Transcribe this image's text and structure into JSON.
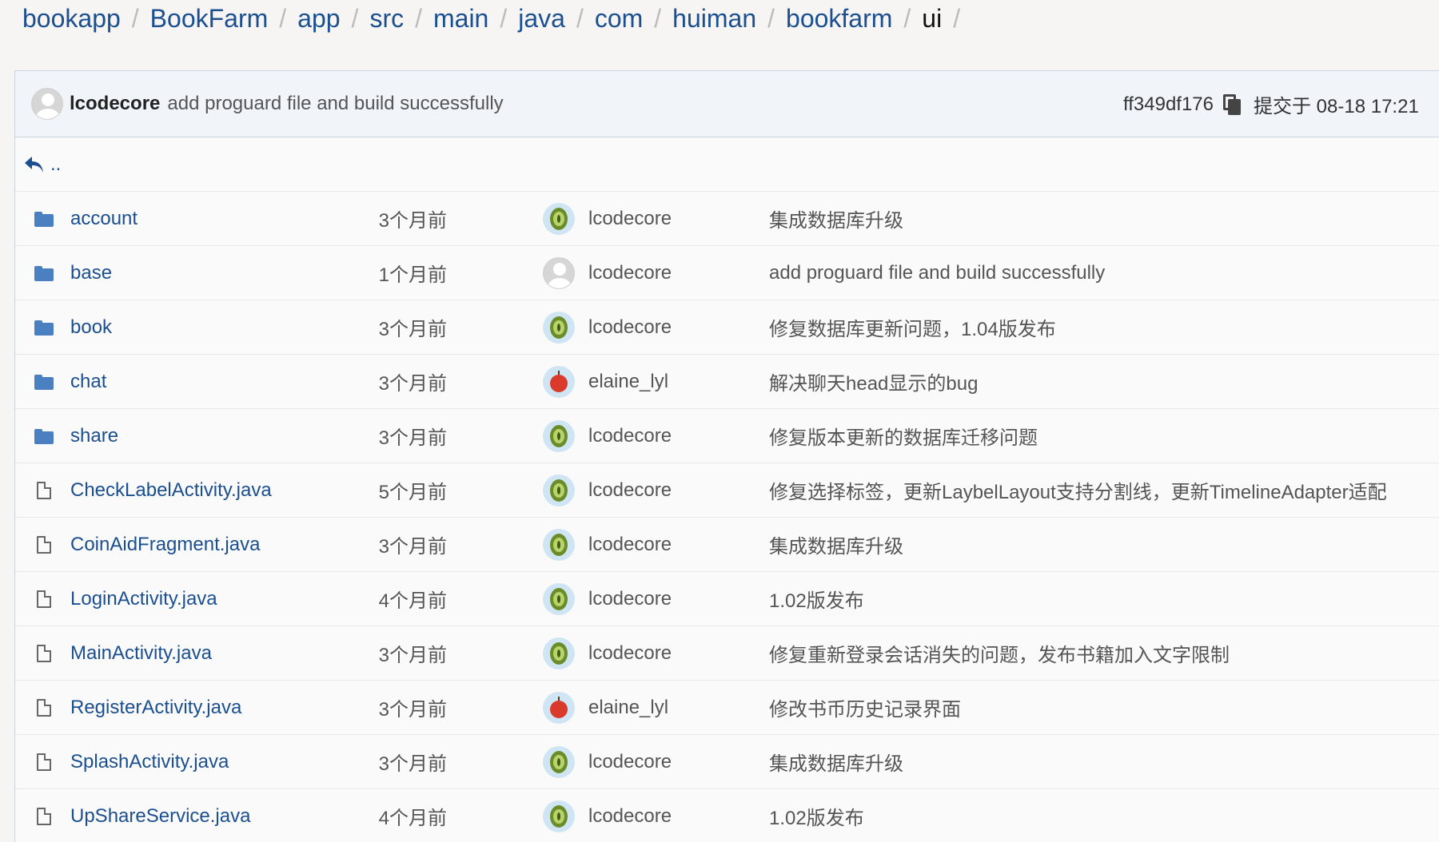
{
  "breadcrumb": [
    {
      "label": "bookapp"
    },
    {
      "label": "BookFarm"
    },
    {
      "label": "app"
    },
    {
      "label": "src"
    },
    {
      "label": "main"
    },
    {
      "label": "java"
    },
    {
      "label": "com"
    },
    {
      "label": "huiman"
    },
    {
      "label": "bookfarm"
    },
    {
      "label": "ui"
    }
  ],
  "breadcrumb_separator": "/",
  "latest_commit": {
    "author": "lcodecore",
    "message": "add proguard file and build successfully",
    "hash": "ff349df176",
    "copy_icon": "clipboard-icon",
    "date": "提交于 08-18 17:21"
  },
  "parent_link": {
    "label": "..",
    "icon": "reply-arrow-icon"
  },
  "rows": [
    {
      "type": "folder",
      "name": "account",
      "time": "3个月前",
      "avatar": "kiwi",
      "author": "lcodecore",
      "message": "集成数据库升级"
    },
    {
      "type": "folder",
      "name": "base",
      "time": "1个月前",
      "avatar": "default",
      "author": "lcodecore",
      "message": "add proguard file and build successfully"
    },
    {
      "type": "folder",
      "name": "book",
      "time": "3个月前",
      "avatar": "kiwi",
      "author": "lcodecore",
      "message": "修复数据库更新问题，1.04版发布"
    },
    {
      "type": "folder",
      "name": "chat",
      "time": "3个月前",
      "avatar": "apple",
      "author": "elaine_lyl",
      "message": "解决聊天head显示的bug"
    },
    {
      "type": "folder",
      "name": "share",
      "time": "3个月前",
      "avatar": "kiwi",
      "author": "lcodecore",
      "message": "修复版本更新的数据库迁移问题"
    },
    {
      "type": "file",
      "name": "CheckLabelActivity.java",
      "time": "5个月前",
      "avatar": "kiwi",
      "author": "lcodecore",
      "message": "修复选择标签，更新LaybelLayout支持分割线，更新TimelineAdapter适配"
    },
    {
      "type": "file",
      "name": "CoinAidFragment.java",
      "time": "3个月前",
      "avatar": "kiwi",
      "author": "lcodecore",
      "message": "集成数据库升级"
    },
    {
      "type": "file",
      "name": "LoginActivity.java",
      "time": "4个月前",
      "avatar": "kiwi",
      "author": "lcodecore",
      "message": "1.02版发布"
    },
    {
      "type": "file",
      "name": "MainActivity.java",
      "time": "3个月前",
      "avatar": "kiwi",
      "author": "lcodecore",
      "message": "修复重新登录会话消失的问题，发布书籍加入文字限制"
    },
    {
      "type": "file",
      "name": "RegisterActivity.java",
      "time": "3个月前",
      "avatar": "apple",
      "author": "elaine_lyl",
      "message": "修改书币历史记录界面"
    },
    {
      "type": "file",
      "name": "SplashActivity.java",
      "time": "3个月前",
      "avatar": "kiwi",
      "author": "lcodecore",
      "message": "集成数据库升级"
    },
    {
      "type": "file",
      "name": "UpShareService.java",
      "time": "4个月前",
      "avatar": "kiwi",
      "author": "lcodecore",
      "message": "1.02版发布"
    }
  ],
  "colors": {
    "link": "#1b4f8f",
    "folder": "#4a7fc2",
    "header_bg": "#f1f5f9",
    "border": "#c9d3de"
  }
}
